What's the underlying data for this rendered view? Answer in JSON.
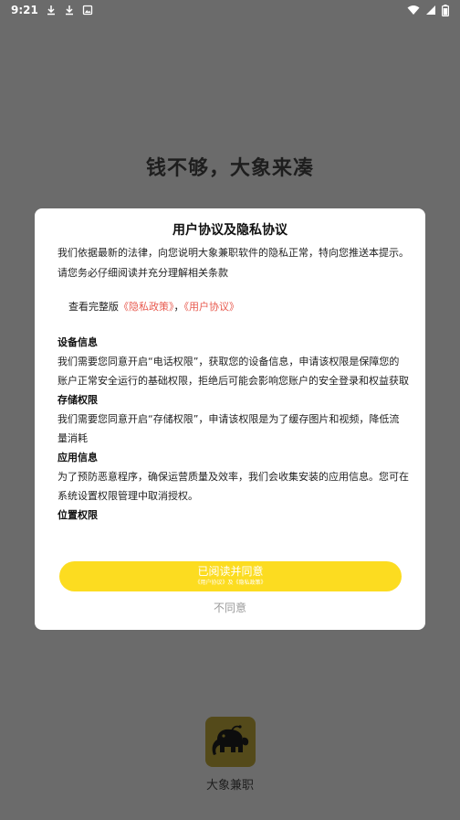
{
  "status_bar": {
    "time": "9:21",
    "icons_left": [
      "download-icon",
      "download-icon",
      "image-notification-icon"
    ],
    "icons_right": [
      "wifi-icon",
      "signal-icon",
      "battery-icon"
    ]
  },
  "slogan": "钱不够，大象来凑",
  "dialog": {
    "title": "用户协议及隐私协议",
    "intro": "我们依据最新的法律，向您说明大象兼职软件的隐私正常，特向您推送本提示。请您务必仔细阅读并充分理解相关条款",
    "links_prefix": "查看完整版",
    "privacy_link": "《隐私政策》",
    "separator": "，",
    "agreement_link": "《用户协议》",
    "sections": [
      {
        "title": "设备信息",
        "body": "我们需要您同意开启“电话权限”，获取您的设备信息，申请该权限是保障您的账户正常安全运行的基础权限，拒绝后可能会影响您账户的安全登录和权益获取"
      },
      {
        "title": "存储权限",
        "body": "我们需要您同意开启“存储权限”，申请该权限是为了缓存图片和视频，降低流量消耗"
      },
      {
        "title": "应用信息",
        "body": "为了预防恶意程序，确保运营质量及效率，我们会收集安装的应用信息。您可在系统设置权限管理中取消授权。"
      },
      {
        "title": "位置权限",
        "body": ""
      }
    ],
    "agree_label": "已阅读并同意",
    "agree_sublabel": "《用户协议》及《隐私政策》",
    "disagree_label": "不同意"
  },
  "app": {
    "name": "大象兼职",
    "logo_icon": "elephant-icon"
  },
  "colors": {
    "overlay": "#6b6b6b",
    "accent": "#fcdc20",
    "link": "#e85a4f",
    "logo_bg": "#544a1a"
  }
}
